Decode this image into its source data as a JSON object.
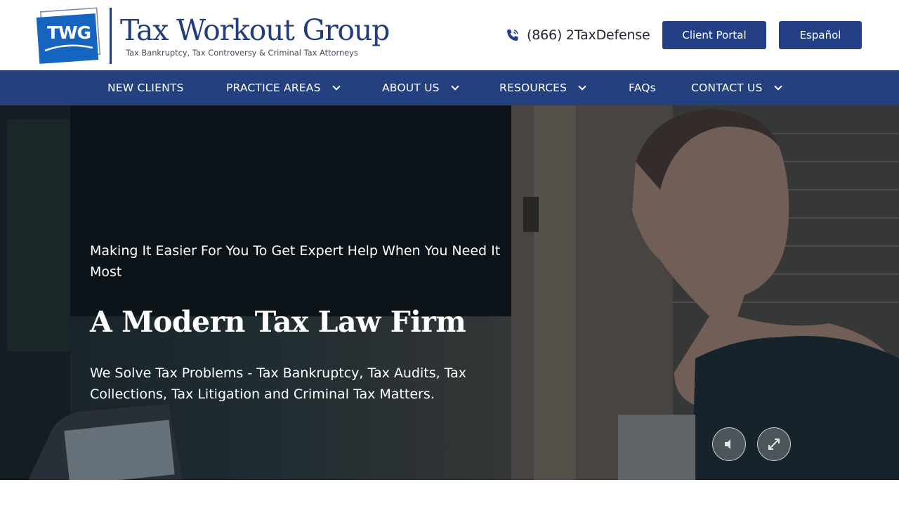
{
  "header": {
    "logo": {
      "mark_text": "TWG",
      "title": "Tax Workout Group",
      "tagline": "Tax Bankruptcy, Tax Controversy & Criminal Tax Attorneys"
    },
    "phone": {
      "icon": "phone-icon",
      "number": "(866) 2TaxDefense"
    },
    "buttons": {
      "client_portal": "Client Portal",
      "espanol": "Español"
    }
  },
  "nav": {
    "items": [
      {
        "label": "NEW CLIENTS",
        "has_dropdown": false
      },
      {
        "label": "PRACTICE AREAS",
        "has_dropdown": true
      },
      {
        "label": "ABOUT US",
        "has_dropdown": true
      },
      {
        "label": "RESOURCES",
        "has_dropdown": true
      },
      {
        "label": "FAQs",
        "has_dropdown": false
      },
      {
        "label": "CONTACT US",
        "has_dropdown": true
      }
    ]
  },
  "hero": {
    "subtitle": "Making It Easier For You To Get Expert Help When You Need It Most",
    "title": "A Modern Tax Law Firm",
    "description": "We Solve Tax Problems - Tax Bankruptcy, Tax Audits, Tax Collections, Tax Litigation and Criminal Tax Matters.",
    "controls": {
      "mute_icon": "speaker-muted-icon",
      "fullscreen_icon": "expand-icon"
    }
  },
  "colors": {
    "brand_navy": "#233f85",
    "nav_bg": "#25407f",
    "logo_blue": "#1565c0",
    "text_dark": "#1f2533"
  }
}
